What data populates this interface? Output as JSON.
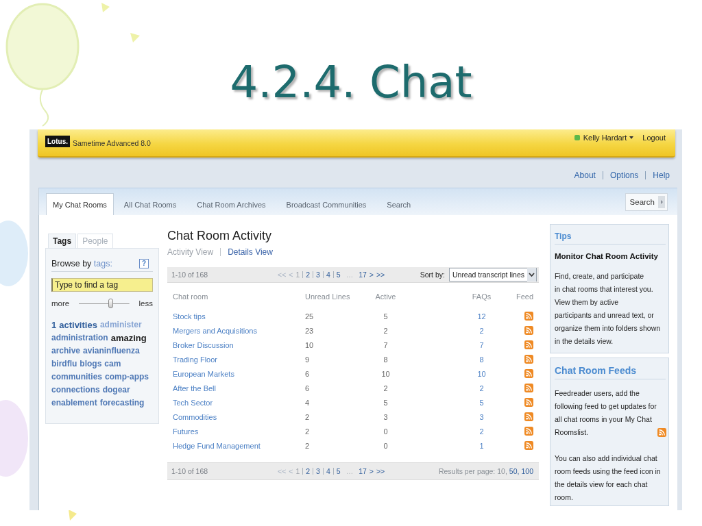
{
  "slide": {
    "title": "4.2.4. Chat"
  },
  "header": {
    "logo": "Lotus.",
    "product": "Sametime Advanced 8.0",
    "user": {
      "name": "Kelly Hardart"
    },
    "logout": "Logout"
  },
  "top_links": [
    "About",
    "Options",
    "Help"
  ],
  "tabs": [
    {
      "label": "My Chat Rooms",
      "selected": true
    },
    {
      "label": "All Chat Rooms",
      "selected": false
    },
    {
      "label": "Chat Room Archives",
      "selected": false
    },
    {
      "label": "Broadcast Communities",
      "selected": false
    },
    {
      "label": "Search",
      "selected": false
    }
  ],
  "search_button": {
    "label": "Search"
  },
  "sidebar": {
    "tabs": [
      {
        "label": "Tags",
        "selected": true
      },
      {
        "label": "People",
        "selected": false
      }
    ],
    "browse": {
      "label": "Browse by",
      "link": "tags:",
      "help": "?"
    },
    "tag_search": {
      "placeholder": "Type to find a tag"
    },
    "slider": {
      "min_label": "more",
      "max_label": "less",
      "level": 0.65
    },
    "tags": [
      {
        "label": "1",
        "kind": "strong"
      },
      {
        "label": "activities",
        "kind": "strong"
      },
      {
        "label": "administer",
        "kind": "light"
      },
      {
        "label": "administration",
        "kind": "medium"
      },
      {
        "label": "amazing",
        "kind": "dark"
      },
      {
        "label": "archive",
        "kind": "medium"
      },
      {
        "label": "avianinfluenza",
        "kind": "medium"
      },
      {
        "label": "birdflu",
        "kind": "medium"
      },
      {
        "label": "blogs",
        "kind": "medium"
      },
      {
        "label": "cam",
        "kind": "medium"
      },
      {
        "label": "communities",
        "kind": "medium"
      },
      {
        "label": "comp-apps",
        "kind": "medium"
      },
      {
        "label": "connections",
        "kind": "medium"
      },
      {
        "label": "dogear",
        "kind": "medium"
      },
      {
        "label": "enablement",
        "kind": "medium"
      },
      {
        "label": "forecasting",
        "kind": "medium"
      }
    ]
  },
  "main": {
    "title": "Chat Room Activity",
    "views": [
      {
        "label": "Activity View",
        "selected": true
      },
      {
        "label": "Details View",
        "selected": false
      }
    ],
    "top_bar": {
      "count": "1-10 of 168",
      "pages": [
        {
          "label": "<<",
          "kind": "nav",
          "disabled": true
        },
        {
          "label": "<",
          "kind": "nav",
          "disabled": true
        },
        {
          "label": "1",
          "kind": "page",
          "selected": true
        },
        {
          "label": "2",
          "kind": "page",
          "selected": false
        },
        {
          "label": "3",
          "kind": "page",
          "selected": false
        },
        {
          "label": "4",
          "kind": "page",
          "selected": false
        },
        {
          "label": "5",
          "kind": "page",
          "selected": false
        },
        {
          "label": "…",
          "kind": "gap"
        },
        {
          "label": "17",
          "kind": "page",
          "selected": false
        },
        {
          "label": ">",
          "kind": "nav",
          "disabled": false
        },
        {
          "label": ">>",
          "kind": "nav",
          "disabled": false
        }
      ],
      "sort": {
        "label": "Sort by:",
        "value": "Unread transcript lines"
      }
    },
    "table": {
      "columns": [
        "Chat room",
        "Unread Lines",
        "Active",
        "FAQs",
        "Feed"
      ],
      "rows": [
        {
          "room": "Stock tips",
          "unread_lines": "25",
          "active": "5",
          "faqs": "12"
        },
        {
          "room": "Mergers and Acquisitions",
          "unread_lines": "23",
          "active": "2",
          "faqs": "2"
        },
        {
          "room": "Broker Discussion",
          "unread_lines": "10",
          "active": "7",
          "faqs": "7"
        },
        {
          "room": "Trading Floor",
          "unread_lines": "9",
          "active": "8",
          "faqs": "8"
        },
        {
          "room": "European Markets",
          "unread_lines": "6",
          "active": "10",
          "faqs": "10"
        },
        {
          "room": "After the Bell",
          "unread_lines": "6",
          "active": "2",
          "faqs": "2"
        },
        {
          "room": "Tech Sector",
          "unread_lines": "4",
          "active": "5",
          "faqs": "5"
        },
        {
          "room": "Commodities",
          "unread_lines": "2",
          "active": "3",
          "faqs": "3"
        },
        {
          "room": "Futures",
          "unread_lines": "2",
          "active": "0",
          "faqs": "2"
        },
        {
          "room": "Hedge Fund Management",
          "unread_lines": "2",
          "active": "0",
          "faqs": "1"
        }
      ]
    },
    "bottom_bar": {
      "count": "1-10 of 168",
      "pages": [
        {
          "label": "<<",
          "kind": "nav",
          "disabled": true
        },
        {
          "label": "<",
          "kind": "nav",
          "disabled": true
        },
        {
          "label": "1",
          "kind": "page",
          "selected": true
        },
        {
          "label": "2",
          "kind": "page",
          "selected": false
        },
        {
          "label": "3",
          "kind": "page",
          "selected": false
        },
        {
          "label": "4",
          "kind": "page",
          "selected": false
        },
        {
          "label": "5",
          "kind": "page",
          "selected": false
        },
        {
          "label": "…",
          "kind": "gap"
        },
        {
          "label": "17",
          "kind": "page",
          "selected": false
        },
        {
          "label": ">",
          "kind": "nav",
          "disabled": false
        },
        {
          "label": ">>",
          "kind": "nav",
          "disabled": false
        }
      ],
      "results_per_page": {
        "label": "Results per page:",
        "options": [
          {
            "label": "10,",
            "selected": true
          },
          {
            "label": "50,",
            "selected": false
          },
          {
            "label": "100",
            "selected": false
          }
        ]
      }
    }
  },
  "tips": {
    "title": "Tips",
    "subtitle": "Monitor Chat Room Activity",
    "text": "Find, create, and participate\nin chat rooms that interest you.\nView them by active\nparticipants and unread text, or\norganize them into folders shown\nin the details view."
  },
  "feeds": {
    "title": "Chat Room Feeds",
    "intro": "Feedreader users, add the\nfollowing feed to get updates for\nall chat rooms in your My Chat\nRoomslist.",
    "note": "You can also add individual chat\nroom feeds using the feed icon in\nthe details view for each chat\nroom."
  }
}
